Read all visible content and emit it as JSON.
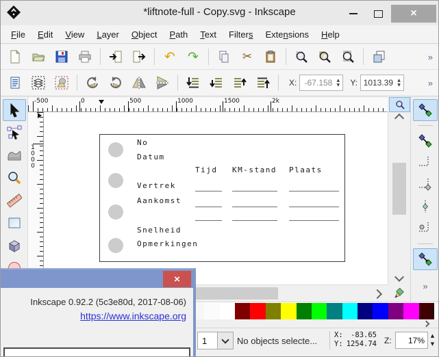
{
  "window": {
    "title": "*liftnote-full - Copy.svg - Inkscape",
    "close_glyph": "×"
  },
  "menus": [
    {
      "label": "File",
      "u": 0
    },
    {
      "label": "Edit",
      "u": 0
    },
    {
      "label": "View",
      "u": 0
    },
    {
      "label": "Layer",
      "u": 0
    },
    {
      "label": "Object",
      "u": 0
    },
    {
      "label": "Path",
      "u": 0
    },
    {
      "label": "Text",
      "u": 0
    },
    {
      "label": "Filters",
      "u": 6
    },
    {
      "label": "Extensions",
      "u": 4
    },
    {
      "label": "Help",
      "u": 0
    }
  ],
  "toolbar_main": {
    "undo_glyph": "↶",
    "redo_glyph": "↷",
    "cut_glyph": "✂",
    "overflow_glyph": "»"
  },
  "toolbar_select": {
    "x_label": "X:",
    "x_value": "-67.158",
    "y_label": "Y:",
    "y_value": "1013.39",
    "spin_up_glyph": "▲",
    "spin_down_glyph": "▼",
    "overflow_glyph": "»"
  },
  "rulers": {
    "h_labels": [
      "-500",
      "0",
      "500",
      "1000",
      "1500",
      "2k"
    ],
    "v_label": "1000"
  },
  "canvas": {
    "labels": {
      "no": "No",
      "datum": "Datum",
      "tijd": "Tijd",
      "kmstand": "KM-stand",
      "plaats": "Plaats",
      "vertrek": "Vertrek",
      "aankomst": "Aankomst",
      "snelheid": "Snelheid",
      "opmerkingen": "Opmerkingen"
    }
  },
  "snapbar": {
    "overflow_glyph": "»"
  },
  "palette": {
    "colors": [
      "#ececec",
      "#f2f2f2",
      "#f7f7f7",
      "#fbfbfb",
      "#ffffff",
      "#800000",
      "#ff0000",
      "#808000",
      "#ffff00",
      "#008000",
      "#00ff00",
      "#008080",
      "#00ffff",
      "#000080",
      "#0000ff",
      "#800080",
      "#ff00ff",
      "#400000"
    ]
  },
  "statusbar": {
    "layer_value": "1",
    "message": "No objects selecte...",
    "x_label": "X:",
    "x_value": "-83.65",
    "y_label": "Y:",
    "y_value": "1254.74",
    "z_label": "Z:",
    "zoom_value": "17%",
    "spin_up_glyph": "▲",
    "spin_down_glyph": "▼"
  },
  "dialog": {
    "version_line": "Inkscape 0.92.2 (5c3e80d, 2017-08-06)",
    "link": "https://www.inkscape.org",
    "close_glyph": "×"
  }
}
